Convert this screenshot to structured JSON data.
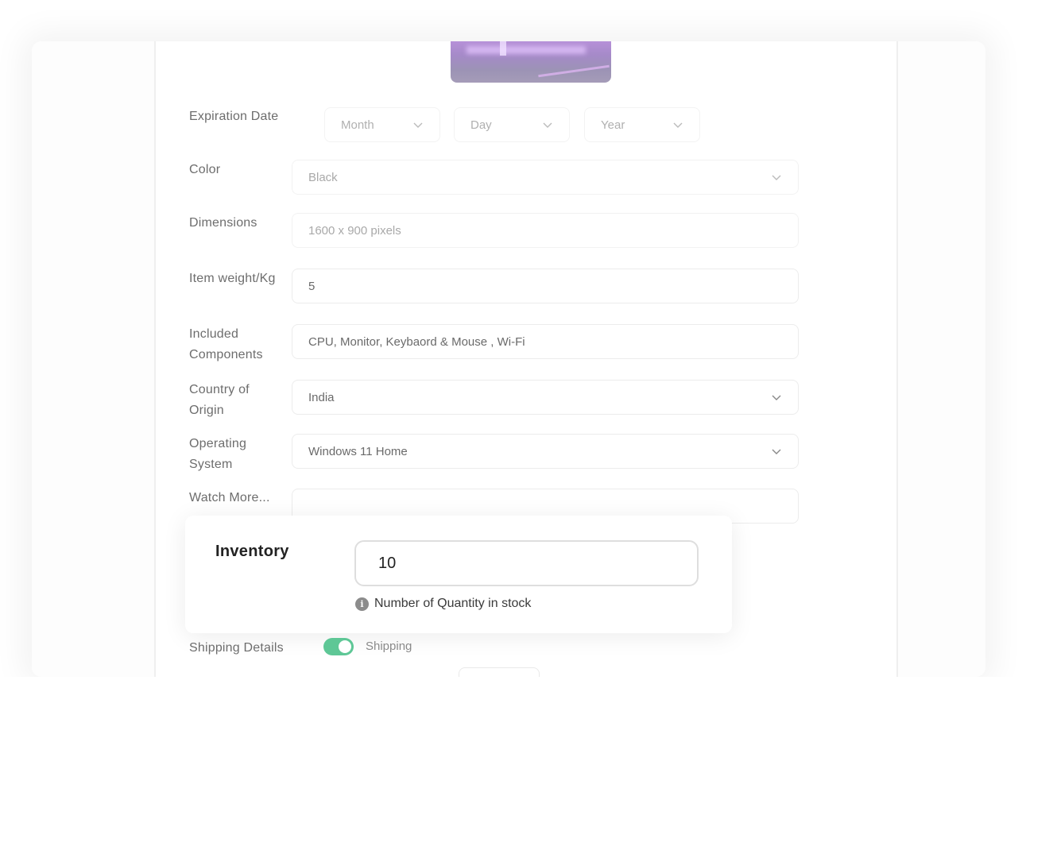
{
  "product": {
    "image_alt": "product-photo-desktop-setup"
  },
  "form": {
    "expiration": {
      "label": "Expiration Date",
      "month": "Month",
      "day": "Day",
      "year": "Year"
    },
    "color": {
      "label": "Color",
      "value": "Black"
    },
    "dimensions": {
      "label": "Dimensions",
      "placeholder": "1600 x 900 pixels"
    },
    "item_weight": {
      "label": "Item weight/Kg",
      "value": "5"
    },
    "included_components": {
      "label": "Included Components",
      "value": "CPU, Monitor, Keybaord & Mouse , Wi-Fi"
    },
    "country_of_origin": {
      "label": "Country of Origin",
      "value": "India"
    },
    "operating_system": {
      "label": "Operating System",
      "value": "Windows 11 Home"
    },
    "watch_more": {
      "label": "Watch More...",
      "value": ""
    },
    "shipping": {
      "label": "Shipping Details",
      "toggle_label": "Shipping",
      "enabled": true
    }
  },
  "inventory": {
    "label": "Inventory",
    "value": "10",
    "help_text": "Number of Quantity in stock"
  },
  "colors": {
    "toggle_on": "#5ec796",
    "info_icon": "#8c8c8c"
  }
}
